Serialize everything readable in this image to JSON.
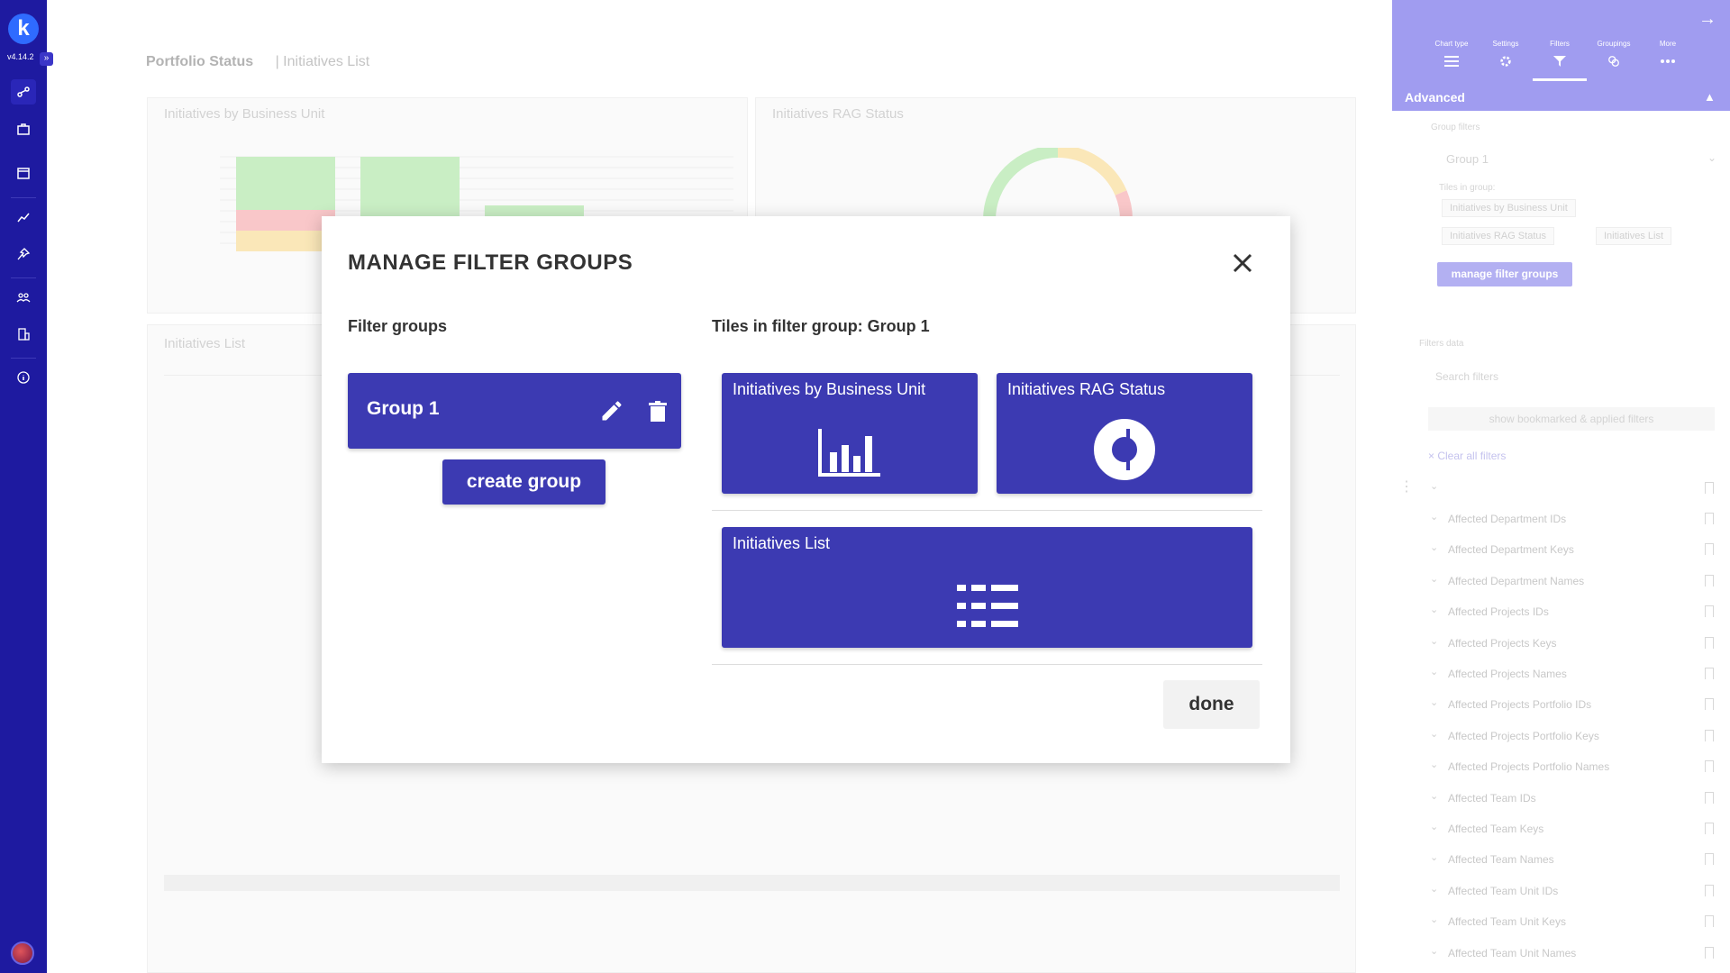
{
  "nav": {
    "logo": "k",
    "version": "v4.14.2",
    "expand": "»"
  },
  "background": {
    "tab_active": "Portfolio Status",
    "tab_other": "| Initiatives List",
    "panels": [
      {
        "title": "Initiatives by Business Unit"
      },
      {
        "title": "Initiatives RAG Status"
      },
      {
        "title": "Initiatives List"
      }
    ]
  },
  "modal": {
    "title": "MANAGE FILTER GROUPS",
    "filter_groups_title": "Filter groups",
    "tiles_title": "Tiles in filter group: Group 1",
    "groups": [
      {
        "name": "Group 1"
      }
    ],
    "create_label": "create group",
    "tiles": [
      {
        "label": "Initiatives by Business Unit",
        "icon": "bar-chart-icon"
      },
      {
        "label": "Initiatives RAG Status",
        "icon": "donut-chart-icon"
      },
      {
        "label": "Initiatives List",
        "icon": "list-icon"
      }
    ],
    "done_label": "done"
  },
  "right_panel": {
    "tabs": [
      {
        "label": "Chart type",
        "icon": "list-icon"
      },
      {
        "label": "Settings",
        "icon": "gear-icon"
      },
      {
        "label": "Filters",
        "icon": "filter-icon",
        "active": true
      },
      {
        "label": "Groupings",
        "icon": "groupings-icon"
      },
      {
        "label": "More",
        "icon": "more-icon"
      }
    ],
    "section": "Advanced",
    "group_filters_label": "Group filters",
    "group_select": "Group 1",
    "tiles_in_group_label": "Tiles in group:",
    "chips": [
      "Initiatives by Business Unit",
      "Initiatives RAG Status",
      "Initiatives List"
    ],
    "manage_label": "manage filter groups",
    "filters_label": "Filters data",
    "search_placeholder": "Search filters",
    "show_bookmarked": "show bookmarked & applied filters",
    "clear_all": "× Clear all filters",
    "filters": [
      "Affected Department IDs",
      "Affected Department Keys",
      "Affected Department Names",
      "Affected Projects IDs",
      "Affected Projects Keys",
      "Affected Projects Names",
      "Affected Projects Portfolio IDs",
      "Affected Projects Portfolio Keys",
      "Affected Projects Portfolio Names",
      "Affected Team IDs",
      "Affected Team Keys",
      "Affected Team Names",
      "Affected Team Unit IDs",
      "Affected Team Unit Keys",
      "Affected Team Unit Names"
    ]
  },
  "colors": {
    "accent": "#3c3ab2",
    "nav": "#1e1aa0",
    "panel_header": "#a09cf0"
  }
}
